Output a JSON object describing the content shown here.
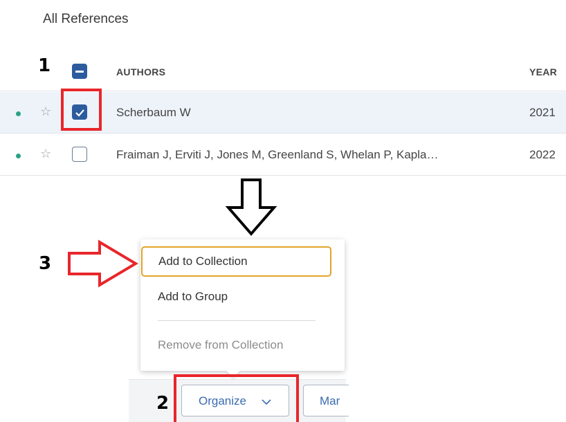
{
  "page": {
    "title": "All References"
  },
  "table": {
    "header": {
      "authors_label": "AUTHORS",
      "year_label": "YEAR",
      "select_all_state": "indeterminate"
    },
    "rows": [
      {
        "authors": "Scherbaum W",
        "year": "2021",
        "checked": true
      },
      {
        "authors": "Fraiman J, Erviti J, Jones M, Greenland S, Whelan P, Kapla…",
        "year": "2022",
        "checked": false
      }
    ]
  },
  "menu": {
    "items": [
      {
        "label": "Add to Collection"
      },
      {
        "label": "Add to Group"
      },
      {
        "label": "Remove from Collection"
      }
    ]
  },
  "toolbar": {
    "organize_label": "Organize",
    "mark_label": "Mar"
  },
  "annotations": {
    "step1": "1",
    "step2": "2",
    "step3": "3"
  },
  "colors": {
    "highlight_red": "#e8262b",
    "accent_blue": "#2c5c9e",
    "menu_focus": "#e2a32a",
    "unread_dot": "#29a383"
  },
  "icons": [
    "star-icon",
    "checkbox-icon",
    "chevron-down-icon",
    "down-arrow-icon",
    "right-arrow-icon"
  ]
}
